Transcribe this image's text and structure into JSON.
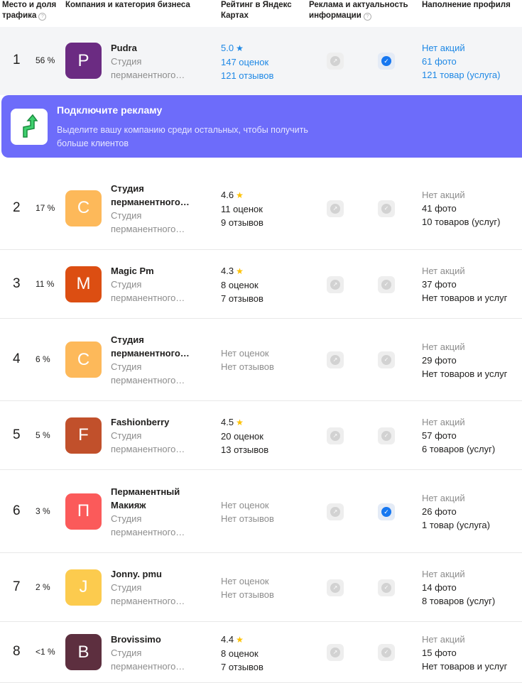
{
  "header": {
    "col1": "Место и доля трафика",
    "col2": "Компания и категория бизнеса",
    "col3": "Рейтинг в Яндекс Картах",
    "col4": "Реклама и актуальность информации",
    "col5": "Наполнение профиля",
    "help_glyph": "?"
  },
  "promo": {
    "title": "Подключите рекламу",
    "text": "Выделите вашу компанию среди остальных, чтобы получить больше клиентов",
    "icon": "arrow-up-icon"
  },
  "star_glyph": "★",
  "check_glyph": "✓",
  "pin_glyph": "↗",
  "rows": [
    {
      "place": "1",
      "share": "56 %",
      "letter": "P",
      "color": "#6b2b82",
      "name1": "Pudra",
      "name2": "",
      "cat1": "Студия",
      "cat2": "перманентного…",
      "rating": "5.0",
      "reviews_count": "147 оценок",
      "reviews_text": "121 отзывов",
      "verified": true,
      "promo_text": "Нет акций",
      "photos": "61 фото",
      "goods": "121 товар (услуга)"
    },
    {
      "place": "2",
      "share": "17 %",
      "letter": "С",
      "color": "#fdb95a",
      "name1": "Студия",
      "name2": "перманентного…",
      "cat1": "Студия",
      "cat2": "перманентного…",
      "rating": "4.6",
      "reviews_count": "11 оценок",
      "reviews_text": "9 отзывов",
      "verified": false,
      "promo_text": "Нет акций",
      "photos": "41 фото",
      "goods": "10 товаров (услуг)"
    },
    {
      "place": "3",
      "share": "11 %",
      "letter": "M",
      "color": "#dc4e12",
      "name1": "Magic Pm",
      "name2": "",
      "cat1": "Студия",
      "cat2": "перманентного…",
      "rating": "4.3",
      "reviews_count": "8 оценок",
      "reviews_text": "7 отзывов",
      "verified": false,
      "promo_text": "Нет акций",
      "photos": "37 фото",
      "goods": "Нет товаров и услуг"
    },
    {
      "place": "4",
      "share": "6 %",
      "letter": "С",
      "color": "#fdb95a",
      "name1": "Студия",
      "name2": "перманентного…",
      "cat1": "Студия",
      "cat2": "перманентного…",
      "rating": "",
      "reviews_count": "Нет оценок",
      "reviews_text": "Нет отзывов",
      "verified": false,
      "promo_text": "Нет акций",
      "photos": "29 фото",
      "goods": "Нет товаров и услуг"
    },
    {
      "place": "5",
      "share": "5 %",
      "letter": "F",
      "color": "#c1502b",
      "name1": "Fashionberry",
      "name2": "",
      "cat1": "Студия",
      "cat2": "перманентного…",
      "rating": "4.5",
      "reviews_count": "20 оценок",
      "reviews_text": "13 отзывов",
      "verified": false,
      "promo_text": "Нет акций",
      "photos": "57 фото",
      "goods": "6 товаров (услуг)"
    },
    {
      "place": "6",
      "share": "3 %",
      "letter": "П",
      "color": "#fb5a5a",
      "name1": "Перманентный",
      "name2": "Макияж",
      "cat1": "Студия",
      "cat2": "перманентного…",
      "rating": "",
      "reviews_count": "Нет оценок",
      "reviews_text": "Нет отзывов",
      "verified": true,
      "promo_text": "Нет акций",
      "photos": "26 фото",
      "goods": "1 товар (услуга)"
    },
    {
      "place": "7",
      "share": "2 %",
      "letter": "J",
      "color": "#fccb4e",
      "name1": "Jonny. pmu",
      "name2": "",
      "cat1": "Студия",
      "cat2": "перманентного…",
      "rating": "",
      "reviews_count": "Нет оценок",
      "reviews_text": "Нет отзывов",
      "verified": false,
      "promo_text": "Нет акций",
      "photos": "14 фото",
      "goods": "8 товаров (услуг)"
    },
    {
      "place": "8",
      "share": "<1 %",
      "letter": "B",
      "color": "#5d2f3f",
      "name1": "Brovissimo",
      "name2": "",
      "cat1": "Студия",
      "cat2": "перманентного…",
      "rating": "4.4",
      "reviews_count": "8 оценок",
      "reviews_text": "7 отзывов",
      "verified": false,
      "promo_text": "Нет акций",
      "photos": "15 фото",
      "goods": "Нет товаров и услуг"
    }
  ]
}
